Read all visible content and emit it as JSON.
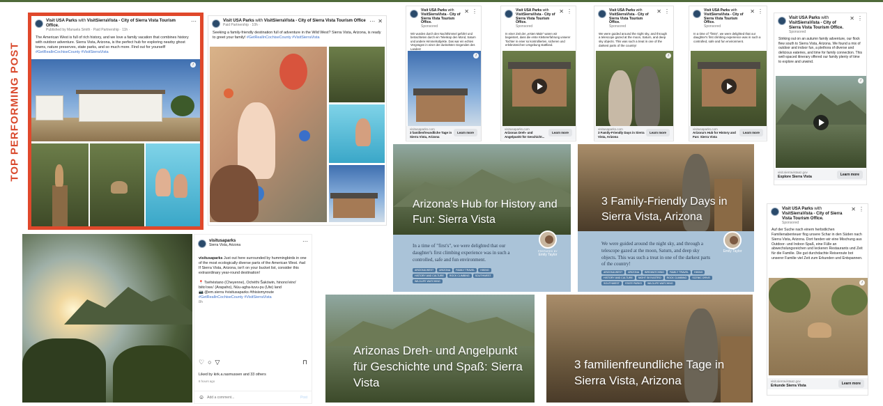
{
  "side_label": "TOP PERFORMING POST",
  "colors": {
    "highlight": "#e0482b",
    "accent_blue": "#3a6fc9",
    "tag_blue": "#4e78a0",
    "quote_box": "#aac3d8",
    "top_rule": "#4f6a3a"
  },
  "icons": {
    "more": "more-horizontal-icon",
    "close": "close-icon",
    "kebab": "more-vertical-icon",
    "info": "info-icon",
    "play": "play-icon"
  },
  "top_post": {
    "page": "Visit USA Parks",
    "with": "with",
    "partner": "VisitSierraVista - City of Sierra Vista Tourism Office.",
    "meta": "Published by Manuela Smith · Paid Partnership · 11h ·",
    "text": "The American West is full of rich history, and we love a family vacation that combines history with outdoor adventure. Sierra Vista, Arizona, is the perfect hub for exploring nearby ghost towns, nature preserves, state parks, and so much more. Find out for yourself!",
    "hashtags": "#GetRealInCochiseCounty #VisitSierraVista"
  },
  "post2": {
    "page": "Visit USA Parks",
    "with": "with",
    "partner": "VisitSierraVista - City of Sierra Vista Tourism Office",
    "meta": "Paid Partnership · 10h ·",
    "text": "Seeking a family-friendly destination full of adventure in the Wild West? Sierra Vista, Arizona, is ready to greet your family!",
    "hashtags": "#GetRealInCochiseCounty #VisitSierraVista"
  },
  "ads": [
    {
      "page": "Visit USA Parks",
      "with": "with",
      "partner": "VisitSierraVista - City of Sierra Vista Tourism Office.",
      "sponsored": "Sponsored",
      "text": "Wir wurden durch den Nachthimmel geführt und betrachteten durch ein Teleskop den Mond, Saturn und andere Himmelsobjekte. Das war ein echtes Vergnügen in einer der dunkelsten Gegenden des Landes!",
      "domain": "visitusaparks.com",
      "title": "3 familienfreundliche Tage in Sierra Vista, Arizona",
      "btn": "Learn more"
    },
    {
      "page": "Visit USA Parks",
      "with": "with",
      "partner": "VisitSierraVista - City of Sierra Vista Tourism Office.",
      "sponsored": "Sponsored",
      "text": "In einer Zeit der „ersten Male\" waren wir begeistert, dass die erste Klettererfahrung unserer Tochter in einer so kontrollierten, sicheren und erlebnisreichen Umgebung stattfand.",
      "domain": "visitusaparks.com",
      "title": "Arizonas Dreh- und Angelpunkt für Geschicht...",
      "btn": "Learn more"
    },
    {
      "page": "Visit USA Parks",
      "with": "with",
      "partner": "VisitSierraVista - City of Sierra Vista Tourism Office.",
      "sponsored": "Sponsored",
      "text": "We were guided around the night sky, and through a telescope gazed at the moon, Saturn, and deep sky objects. This was such a treat in one of the darkest parts of the country!",
      "domain": "visitusaparks.com",
      "title": "3 Family-Friendly Days in Sierra Vista, Arizona",
      "btn": "Learn more"
    },
    {
      "page": "Visit USA Parks",
      "with": "with",
      "partner": "VisitSierraVista - City of Sierra Vista Tourism Office.",
      "sponsored": "Sponsored",
      "text": "In a time of \"firsts\", we were delighted that our daughter's first climbing experience was in such a controlled, safe and fun environment.",
      "domain": "visitusaparks.com",
      "title": "Arizona's Hub for History and Fun: Sierra Vista",
      "btn": "Learn more"
    }
  ],
  "right_ad_1": {
    "page": "Visit USA Parks",
    "with": "with",
    "partner": "VisitSierraVista - City of Sierra Vista Tourism Office.",
    "sponsored": "Sponsored",
    "text": "Striking out on an autumn family adventure, our flock flew south to Sierra Vista, Arizona. We found a mix of outdoor and indoor fun, a plethora of diverse and delicious eateries, and time for family connection. This well-spaced itinerary offered our family plenty of time to explore and unwind.",
    "domain": "visit.sierravistaaz.gov",
    "title": "Explore Sierra Vista",
    "btn": "Learn more"
  },
  "right_ad_2": {
    "page": "Visit USA Parks",
    "with": "with",
    "partner": "VisitSierraVista - City of Sierra Vista Tourism Office.",
    "sponsored": "Sponsored",
    "text": "Auf der Suche nach einem herbstlichen Familienabenteuer flog unsere Schar in den Süden nach Sierra Vista, Arizona. Dort fanden wir eine Mischung aus Outdoor- und Indoor-Spaß, eine Fülle an abwechslungsreichen und leckeren Restaurants und Zeit für die Familie. Die gut durchdachte Reiseroute bot unserer Familie viel Zeit zum Erkunden und Entspannen.",
    "domain": "visit.sierravistaaz.gov",
    "title": "Erkunde Sierra Vista",
    "btn": "Learn more"
  },
  "blog_hub": {
    "headline": "Arizona's Hub for History and Fun: Sierra Vista",
    "quote": "In a time of \"first's\", we were delighted that our daughter's first climbing experience was in such a controlled, safe and fun environment.",
    "prepared_by": "PREPARED BY",
    "author": "Emily Taylor",
    "tags": [
      "ARIZONA WEST",
      "ARIZONA",
      "FAMILY TRAVEL",
      "HIKING",
      "HISTORY AND CULTURE",
      "ROCK CLIMBING",
      "SOUTHWEST",
      "WILDLIFE WATCHING"
    ]
  },
  "blog_days": {
    "headline": "3 Family-Friendly Days in Sierra Vista, Arizona",
    "quote": "We were guided around the night sky, and through a telescope gazed at the moon, Saturn, and deep sky objects. This was such a treat in one of the darkest parts of the country!",
    "prepared_by": "PREPARED BY",
    "author": "Emily Taylor",
    "tags": [
      "ARIZONA WEST",
      "ARIZONA",
      "BIRDWATCHING",
      "FAMILY TRAVEL",
      "HIKING",
      "HISTORY AND CULTURE",
      "NIGHT SKY/ASTRO",
      "ROCK CLIMBING",
      "SCENIC DRIVE",
      "SOUTHWEST",
      "STATE PARKS",
      "WILDLIFE WATCHING"
    ]
  },
  "blog_de_hub": {
    "headline": "Arizonas Dreh- und Angelpunkt für Geschichte und Spaß: Sierra Vista"
  },
  "blog_de_days": {
    "headline": "3 familienfreundliche Tage in Sierra Vista, Arizona"
  },
  "instagram": {
    "user": "visitusaparks",
    "location": "Sierra Vista, Arizona",
    "caption_user": "visitusaparks",
    "caption": "Just out here surrounded by hummingbirds in one of the most ecologically diverse parts of the American West. #ad If Sierra Vista, Arizona, isn't on your bucket list, consider this extraordinary year-round destination!",
    "land": "📍 Tsėhéstano (Cheyenne), Ochéthi Šakówin, hinono'eino' biito'owu' (Arapaho), Núu-agha-tuvu-pu (Ute) land",
    "credit": "📷 @em.sierra #visitusaparks #thisismyroute",
    "hashtags": "#GetRealInCochiseCounty #VisitSierraVista",
    "age": "8h",
    "likes": "Liked by kirk.a.rasmussen and 33 others",
    "time": "8 hours ago",
    "comment_placeholder": "Add a comment...",
    "post_btn": "Post"
  }
}
